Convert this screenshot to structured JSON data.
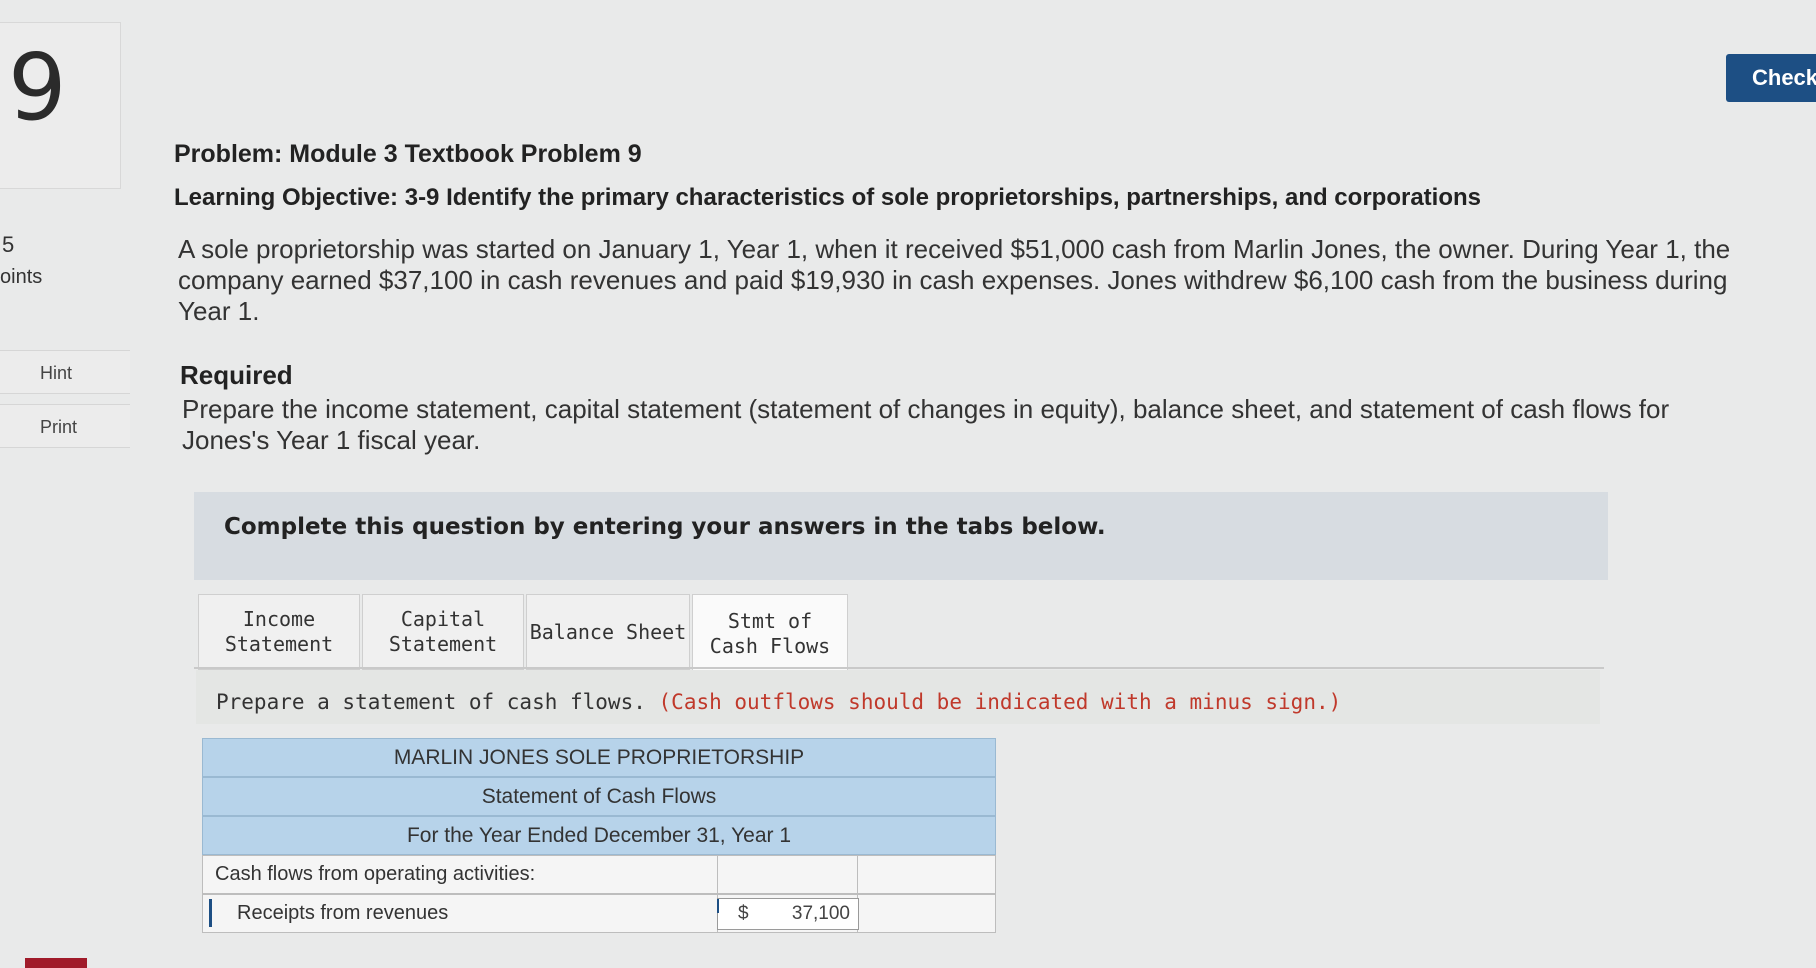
{
  "question": {
    "number": "9",
    "points_value": "5",
    "points_label": "oints"
  },
  "sidebar": {
    "hint_label": "Hint",
    "print_label": "Print"
  },
  "toolbar": {
    "check_label": "Check"
  },
  "problem": {
    "title": "Problem: Module 3 Textbook Problem 9",
    "objective": "Learning Objective: 3-9 Identify the primary characteristics of sole proprietorships, partnerships, and corporations",
    "text": "A sole proprietorship was started on January 1, Year 1, when it received $51,000 cash from Marlin Jones, the owner. During Year 1, the company earned $37,100 in cash revenues and paid $19,930 in cash expenses. Jones withdrew $6,100 cash from the business during Year 1."
  },
  "required": {
    "title": "Required",
    "text": "Prepare the income statement, capital statement (statement of changes in equity), balance sheet, and statement of cash flows for Jones's Year 1 fiscal year."
  },
  "instructions_banner": "Complete this question by entering your answers in the tabs below.",
  "tabs": [
    {
      "label": "Income Statement",
      "active": false
    },
    {
      "label": "Capital Statement",
      "active": false
    },
    {
      "label": "Balance Sheet",
      "active": false
    },
    {
      "label": "Stmt of Cash Flows",
      "active": true
    }
  ],
  "tab_instruction": {
    "main": "Prepare a statement of cash flows.",
    "note": "(Cash outflows should be indicated with a minus sign.)"
  },
  "statement": {
    "company": "MARLIN JONES SOLE PROPRIETORSHIP",
    "title": "Statement of Cash Flows",
    "period": "For the Year Ended December 31, Year 1",
    "section_label": "Cash flows from operating activities:",
    "row1_label": "Receipts from revenues",
    "row1_currency": "$",
    "row1_value": "37,100"
  },
  "colors": {
    "accent": "#1d4f84",
    "header_blue": "#b7d3ea",
    "note_red": "#c0392b"
  }
}
